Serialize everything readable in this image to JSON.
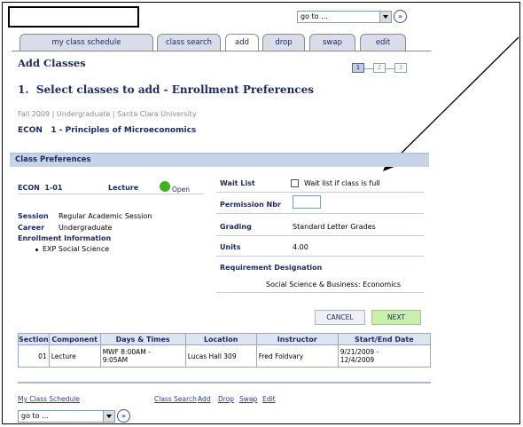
{
  "page": {
    "goto_select": {
      "value": "go to ..."
    },
    "tabs": [
      {
        "label": "my class schedule",
        "active": false
      },
      {
        "label": "class search",
        "active": false
      },
      {
        "label": "add",
        "active": true
      },
      {
        "label": "drop",
        "active": false
      },
      {
        "label": "swap",
        "active": false
      },
      {
        "label": "edit",
        "active": false
      }
    ],
    "heading": "Add Classes",
    "steps": [
      "1",
      "2",
      "3"
    ],
    "step_title": "1.  Select classes to add - Enrollment Preferences",
    "term_line": "Fall 2009 | Undergraduate | Santa Clara University",
    "course_title": "ECON   1 - Principles of Microeconomics"
  },
  "preferences": {
    "header": "Class Preferences",
    "class_section": "ECON  1-01",
    "component": "Lecture",
    "status": "Open",
    "session_label": "Session",
    "session_value": "Regular Academic Session",
    "career_label": "Career",
    "career_value": "Undergraduate",
    "enroll_info_label": "Enrollment Information",
    "enroll_info_item": "EXP Social Science",
    "wait_list_label": "Wait List",
    "wait_list_checkbox_text": "Wait list if class is full",
    "permission_label": "Permission Nbr",
    "permission_value": "",
    "grading_label": "Grading",
    "grading_value": "Standard Letter Grades",
    "units_label": "Units",
    "units_value": "4.00",
    "req_label": "Requirement Designation",
    "req_value": "Social Science & Business: Economics",
    "cancel_label": "CANCEL",
    "next_label": "NEXT"
  },
  "sections_table": {
    "headers": [
      "Section",
      "Component",
      "Days & Times",
      "Location",
      "Instructor",
      "Start/End Date"
    ],
    "rows": [
      [
        "01",
        "Lecture",
        "MWF 8:00AM -\n9:05AM",
        "Lucas Hall 309",
        "Fred Foldvary",
        "9/21/2009 -\n12/4/2009"
      ]
    ]
  },
  "footer": {
    "links": [
      "My Class Schedule",
      "Class Search",
      "Add",
      "Drop",
      "Swap",
      "Edit"
    ],
    "goto_select": {
      "value": "go to ..."
    }
  },
  "colors": {
    "navy": "#1c2a66",
    "tab_bg": "#d8dde9",
    "section_header_bg": "#c7d3e6",
    "open_green": "#3ab51e",
    "next_button_bg": "#c8f0a8"
  }
}
